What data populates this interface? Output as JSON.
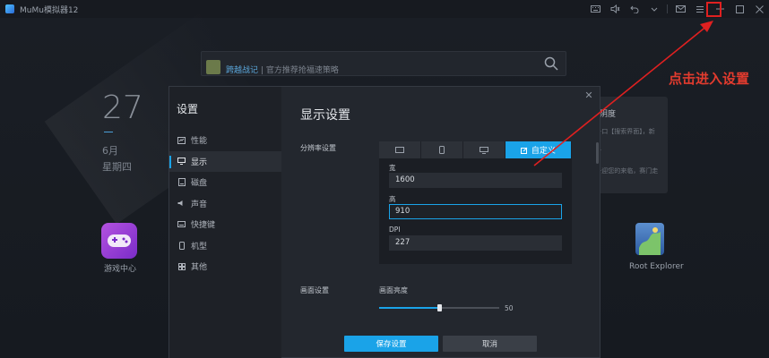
{
  "window": {
    "title": "MuMu模拟器12",
    "icons": [
      "keyboard-icon",
      "volume-icon",
      "back-icon",
      "dropdown-icon",
      "mail-icon",
      "menu-icon",
      "minimize-icon",
      "maximize-icon",
      "close-icon"
    ]
  },
  "desktop": {
    "search": {
      "link_text": "跨越战记",
      "separator": "|",
      "hint": "官方推荐抢福速策略"
    },
    "date": {
      "day": "27",
      "month": "6月",
      "weekday": "星期四"
    },
    "card": {
      "title": "阴度",
      "lines": [
        "·口【搜索界面】，新",
        "·",
        "·迎您的来临，赛门走"
      ]
    },
    "apps": [
      {
        "label": "游戏中心",
        "icon": "gamepad-icon"
      },
      {
        "label": "Root Explorer",
        "icon": "root-explorer-icon"
      }
    ]
  },
  "annotation": {
    "text": "点击进入设置",
    "color": "#e23b2e"
  },
  "dialog": {
    "sidebar_title": "设置",
    "sidebar_items": [
      {
        "label": "性能",
        "icon": "performance-icon"
      },
      {
        "label": "显示",
        "icon": "display-icon"
      },
      {
        "label": "磁盘",
        "icon": "disk-icon"
      },
      {
        "label": "声音",
        "icon": "sound-icon"
      },
      {
        "label": "快捷键",
        "icon": "keyboard-icon"
      },
      {
        "label": "机型",
        "icon": "phone-icon"
      },
      {
        "label": "其他",
        "icon": "grid-icon"
      }
    ],
    "active_item": "显示",
    "heading": "显示设置",
    "resolution": {
      "label": "分辨率设置",
      "tabs": [
        "tablet-landscape-icon",
        "phone-portrait-icon",
        "monitor-icon"
      ],
      "custom_tab": "自定义",
      "width_label": "宽",
      "width_value": "1600",
      "height_label": "高",
      "height_value": "910",
      "dpi_label": "DPI",
      "dpi_value": "227"
    },
    "screen": {
      "label": "画面设置",
      "brightness_label": "画面亮度",
      "brightness_value": "50",
      "brightness_fraction": 0.5
    },
    "save_button": "保存设置",
    "cancel_button": "取消",
    "accent_color": "#1aa3e8"
  }
}
